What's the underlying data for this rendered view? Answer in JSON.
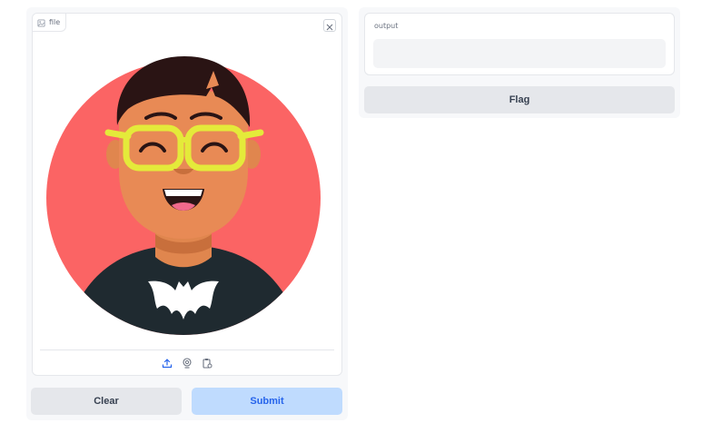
{
  "image_input": {
    "label": "file",
    "icons": [
      "image-icon",
      "close-icon",
      "upload-icon",
      "webcam-icon",
      "clipboard-icon"
    ]
  },
  "actions": {
    "clear_label": "Clear",
    "submit_label": "Submit"
  },
  "output": {
    "label": "output",
    "value": "",
    "flag_label": "Flag"
  },
  "colors": {
    "submit_bg": "#bfdbfe",
    "submit_text": "#2563eb",
    "neutral_button": "#e5e7eb",
    "avatar_background": "#fb6464"
  }
}
